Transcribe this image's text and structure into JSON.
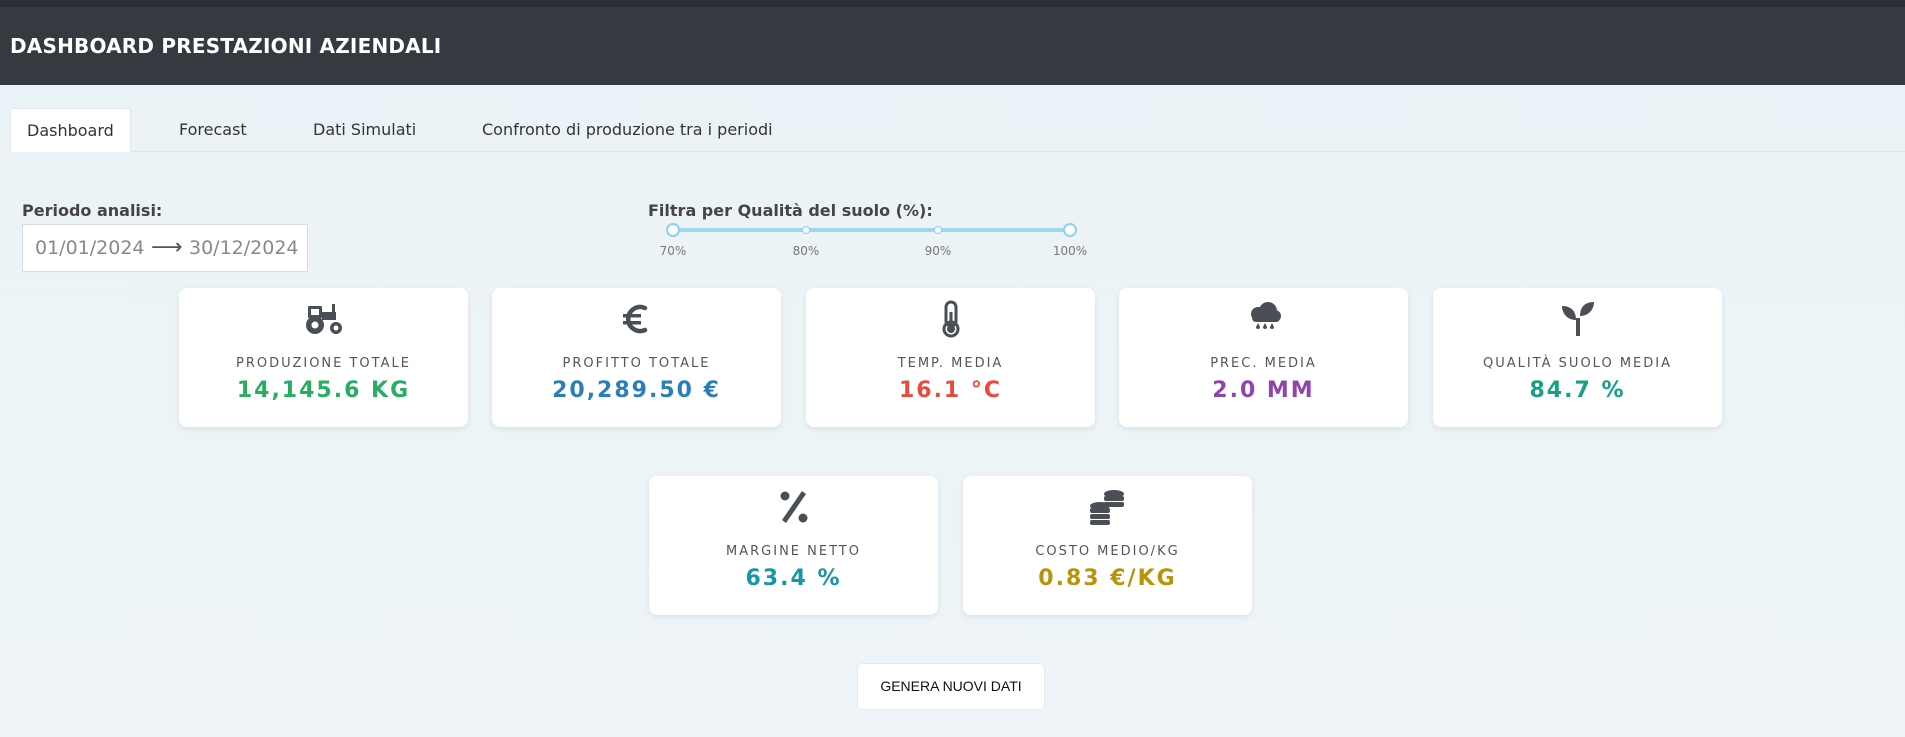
{
  "header": {
    "title": "DASHBOARD PRESTAZIONI AZIENDALI"
  },
  "tabs": [
    {
      "label": "Dashboard",
      "active": true
    },
    {
      "label": "Forecast",
      "active": false
    },
    {
      "label": "Dati Simulati",
      "active": false
    },
    {
      "label": "Confronto di produzione tra i periodi",
      "active": false
    }
  ],
  "period": {
    "label": "Periodo analisi:",
    "start": "01/01/2024",
    "arrow": "⟶",
    "end": "30/12/2024"
  },
  "soil_filter": {
    "label": "Filtra per Qualità del suolo (%):",
    "marks": [
      "70%",
      "80%",
      "90%",
      "100%"
    ],
    "range": [
      70,
      100
    ]
  },
  "kpis": [
    {
      "icon": "tractor-icon",
      "label": "PRODUZIONE TOTALE",
      "value": "14,145.6 KG",
      "color": "#27ae60"
    },
    {
      "icon": "euro-icon",
      "label": "PROFITTO TOTALE",
      "value": "20,289.50 €",
      "color": "#2980b9"
    },
    {
      "icon": "thermometer-icon",
      "label": "TEMP. MEDIA",
      "value": "16.1 °C",
      "color": "#e74c3c"
    },
    {
      "icon": "cloud-rain-icon",
      "label": "PREC. MEDIA",
      "value": "2.0 MM",
      "color": "#8e44ad"
    },
    {
      "icon": "seedling-icon",
      "label": "QUALITÀ SUOLO MEDIA",
      "value": "84.7 %",
      "color": "#16a085"
    },
    {
      "icon": "percent-icon",
      "label": "MARGINE NETTO",
      "value": "63.4 %",
      "color": "#1797a6"
    },
    {
      "icon": "coins-icon",
      "label": "COSTO MEDIO/KG",
      "value": "0.83 €/KG",
      "color": "#b7950b"
    }
  ],
  "actions": {
    "generate_label": "GENERA NUOVI DATI"
  }
}
